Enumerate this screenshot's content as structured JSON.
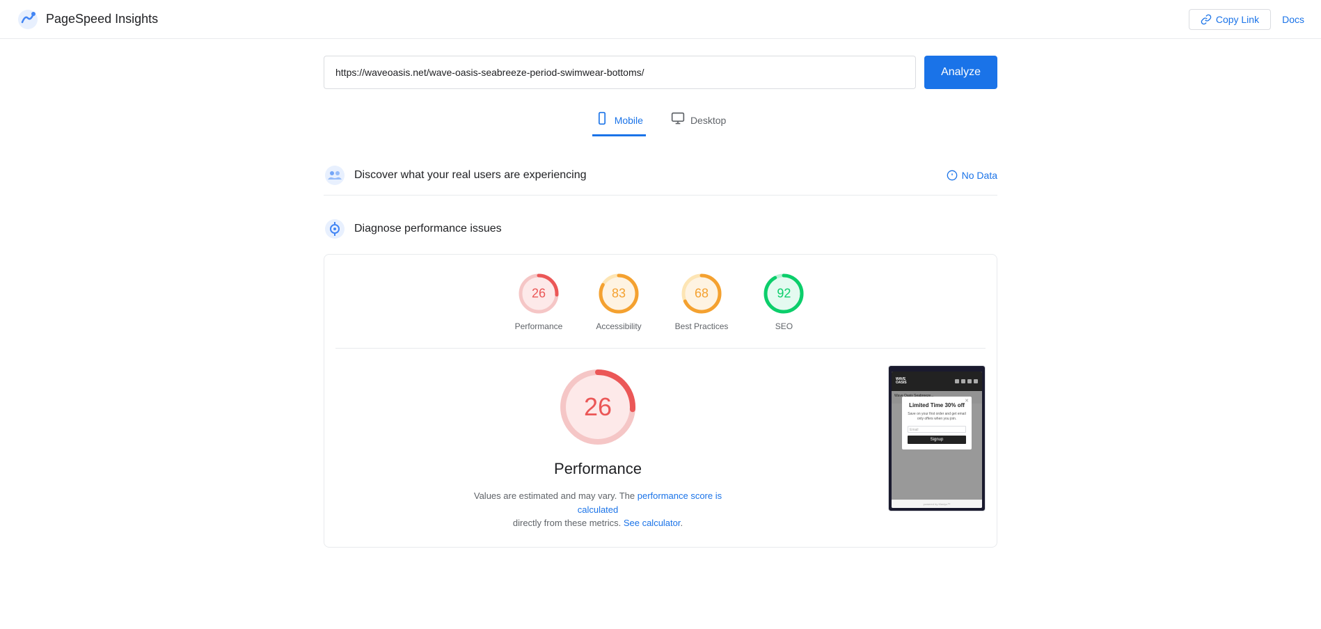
{
  "header": {
    "app_title": "PageSpeed Insights",
    "copy_link_label": "Copy Link",
    "docs_label": "Docs"
  },
  "search": {
    "url_value": "https://waveoasis.net/wave-oasis-seabreeze-period-swimwear-bottoms/",
    "analyze_label": "Analyze"
  },
  "tabs": [
    {
      "id": "mobile",
      "label": "Mobile",
      "active": true
    },
    {
      "id": "desktop",
      "label": "Desktop",
      "active": false
    }
  ],
  "sections": {
    "real_users": {
      "title": "Discover what your real users are experiencing",
      "no_data_label": "No Data"
    },
    "diagnose": {
      "title": "Diagnose performance issues"
    }
  },
  "scores": [
    {
      "id": "performance",
      "value": 26,
      "label": "Performance",
      "color": "#eb5757",
      "track_color": "#fde9e9",
      "pct": 26
    },
    {
      "id": "accessibility",
      "value": 83,
      "label": "Accessibility",
      "color": "#f4a130",
      "track_color": "#fef3e2",
      "pct": 83
    },
    {
      "id": "best_practices",
      "value": 68,
      "label": "Best Practices",
      "color": "#f4a130",
      "track_color": "#fef3e2",
      "pct": 68
    },
    {
      "id": "seo",
      "value": 92,
      "label": "SEO",
      "color": "#0cce6b",
      "track_color": "#e4faf0",
      "pct": 92
    }
  ],
  "big_score": {
    "value": 26,
    "title": "Performance",
    "desc_static": "Values are estimated and may vary. The",
    "desc_link1": "performance score is calculated",
    "desc_middle": "directly from these metrics.",
    "desc_link2": "See calculator",
    "desc_end": "."
  },
  "phone_modal": {
    "header_brand": "WAVE\nOASIS",
    "title": "Limited Time\n30% off",
    "subtitle": "Save on your first order and get email only offers when you join.",
    "input_placeholder": "Email",
    "btn_label": "Signup"
  },
  "colors": {
    "accent": "#1a73e8",
    "performance_red": "#eb5757",
    "accessibility_orange": "#f4a130",
    "best_practices_orange": "#f4a130",
    "seo_green": "#0cce6b"
  }
}
